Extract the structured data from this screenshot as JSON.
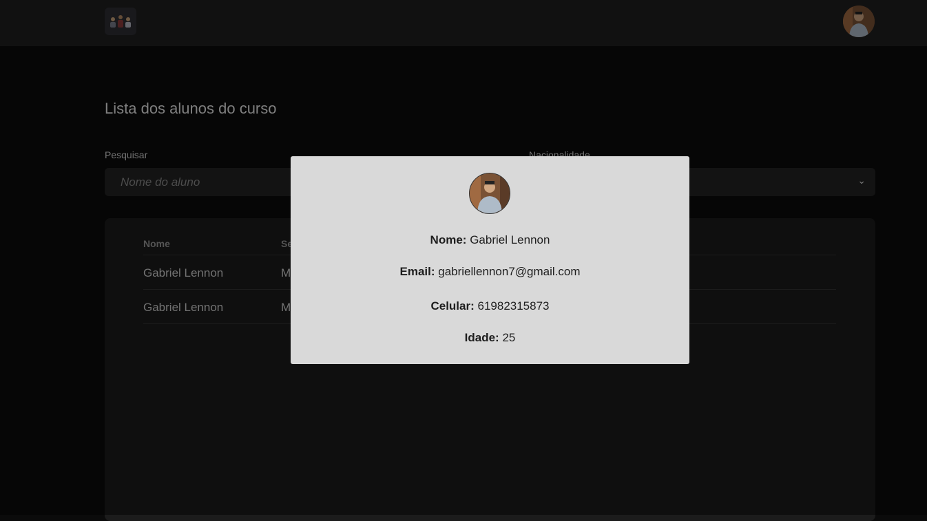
{
  "header": {
    "logo_icon": "students-group-icon",
    "avatar_icon": "user-avatar"
  },
  "main": {
    "title": "Lista dos alunos do curso",
    "search": {
      "label": "Pesquisar",
      "placeholder": "Nome do aluno"
    },
    "nationality": {
      "label": "Nacionalidade",
      "value": ""
    }
  },
  "table": {
    "columns": [
      "Nome",
      "Se"
    ],
    "rows": [
      {
        "name": "Gabriel Lennon",
        "sex": "M"
      },
      {
        "name": "Gabriel Lennon",
        "sex": "M"
      }
    ]
  },
  "modal": {
    "name_label": "Nome:",
    "name_value": "Gabriel Lennon",
    "email_label": "Email:",
    "email_value": "gabriellennon7@gmail.com",
    "phone_label": "Celular:",
    "phone_value": "61982315873",
    "age_label": "Idade:",
    "age_value": "25"
  },
  "colors": {
    "background": "#0b0b0b",
    "topbar": "#1f1f1f",
    "card": "#1c1c1c",
    "modal": "#d9d9d9"
  }
}
